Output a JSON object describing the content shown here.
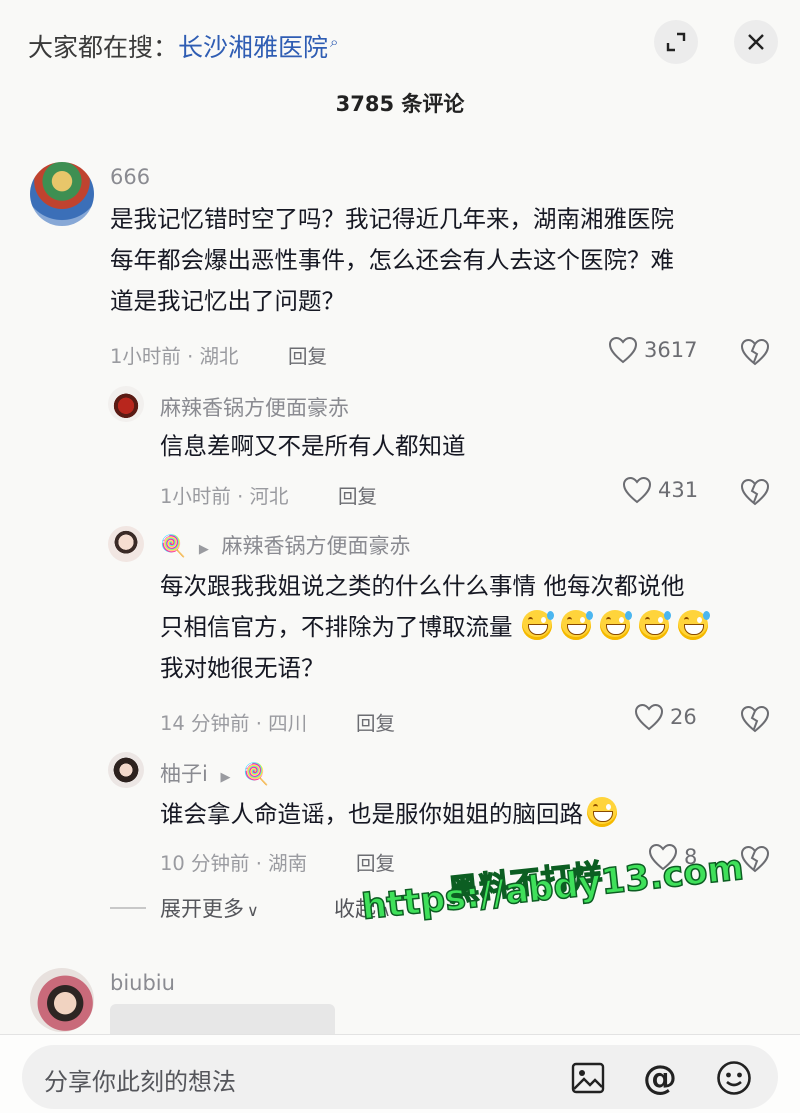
{
  "header": {
    "search_prefix": "大家都在搜：",
    "search_term": "长沙湘雅医院",
    "comment_count_title": "3785 条评论"
  },
  "comments": [
    {
      "username": "666",
      "text_lines": [
        "是我记忆错时空了吗？我记得近几年来，湖南湘雅医院",
        "每年都会爆出恶性事件，怎么还会有人去这个医院？难",
        "道是我记忆出了问题？"
      ],
      "meta": "1小时前 · 湖北",
      "reply_label": "回复",
      "likes": "3617"
    },
    {
      "username": "麻辣香锅方便面豪赤",
      "text_lines": [
        "信息差啊又不是所有人都知道"
      ],
      "meta": "1小时前 · 河北",
      "reply_label": "回复",
      "likes": "431"
    },
    {
      "username_icon": "🍭",
      "reply_to": "麻辣香锅方便面豪赤",
      "text_lines": [
        "每次跟我我姐说之类的什么什么事情 他每次都说他",
        "只相信官方，不排除为了博取流量",
        "我对她很无语？"
      ],
      "meta": "14 分钟前 · 四川",
      "reply_label": "回复",
      "likes": "26"
    },
    {
      "username": "柚子i",
      "username_icon": "🍭",
      "text_lines": [
        "谁会拿人命造谣，也是服你姐姐的脑回路"
      ],
      "meta": "10 分钟前 · 湖南",
      "reply_label": "回复",
      "likes": "8"
    },
    {
      "username": "biubiu"
    }
  ],
  "thread_controls": {
    "expand_label": "展开更多",
    "collapse_label": "收起"
  },
  "watermark": {
    "line1": "黑料不打烊",
    "line2": "https://abdy13.com"
  },
  "composer": {
    "placeholder": "分享你此刻的想法"
  },
  "colors": {
    "link": "#2f5db3",
    "watermark": "#3fe05a",
    "background": "#f9f9f7"
  }
}
